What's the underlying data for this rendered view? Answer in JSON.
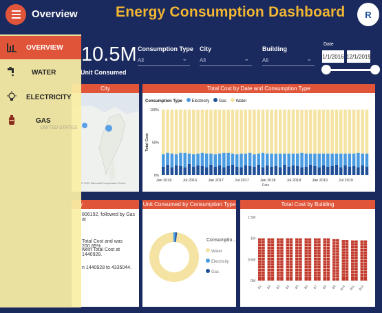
{
  "header": {
    "page_title": "Overview",
    "dashboard_title": "Energy Consumption Dashboard"
  },
  "kpi": {
    "value": "10.5M",
    "label": "Unit Consumed"
  },
  "filters": {
    "consumption_type": {
      "label": "Consumption Type",
      "value": "All"
    },
    "city": {
      "label": "City",
      "value": "All"
    },
    "building": {
      "label": "Building",
      "value": "All"
    },
    "date": {
      "label": "Date",
      "start": "1/1/2016",
      "end": "12/1/2019"
    }
  },
  "nav": {
    "items": [
      {
        "label": "OVERVIEW",
        "icon": "bar-chart-icon",
        "active": true
      },
      {
        "label": "WATER",
        "icon": "faucet-icon",
        "active": false
      },
      {
        "label": "ELECTRICITY",
        "icon": "bulb-icon",
        "active": false
      },
      {
        "label": "GAS",
        "icon": "gas-cylinder-icon",
        "active": false
      }
    ]
  },
  "map_panel": {
    "title": "City",
    "attribution": "© 2022 Microsoft Corporation  Terms",
    "faded_text": [
      "UNITED STATES"
    ]
  },
  "insights_panel": {
    "title": "y",
    "lines": [
      "806192, followed by Gas at",
      "Total Cost and was 200.85%",
      "west Total Cost at 1440928.",
      "n 1440928 to 4335044."
    ]
  },
  "cost_by_date_panel": {
    "title": "Total Cost by Date and Consumption Type",
    "legend_title": "Consumption Type",
    "xlabel": "Date",
    "ylabel": "Total Cost"
  },
  "unit_by_type_panel": {
    "title": "Unit Consumed by Consumption Type",
    "legend_title": "Consumptio...",
    "legend": [
      "Water",
      "Electricity",
      "Gas"
    ]
  },
  "cost_by_building_panel": {
    "title": "Total Cost by Building"
  },
  "colors": {
    "navy": "#1b2a5e",
    "accent_orange": "#e0553a",
    "title_gold": "#f2b632",
    "water": "#f5e3a3",
    "electricity": "#4a9be0",
    "gas": "#1f4f96",
    "building_bar": "#c0392b"
  },
  "chart_data": [
    {
      "type": "bar",
      "title": "Total Cost by Date and Consumption Type",
      "xlabel": "Date",
      "ylabel": "Total Cost",
      "stacked": "100%",
      "x_ticks": [
        "Jan 2016",
        "Jul 2016",
        "Jan 2017",
        "Jul 2017",
        "Jan 2018",
        "Jul 2018",
        "Jan 2019",
        "Jul 2019"
      ],
      "y_ticks": [
        "0%",
        "50%",
        "100%"
      ],
      "ylim": [
        0,
        100
      ],
      "n_periods": 48,
      "series": [
        {
          "name": "Gas",
          "values": [
            13,
            16,
            12,
            15,
            14,
            12,
            17,
            13,
            15,
            14,
            12,
            16,
            13,
            15,
            12,
            14,
            16,
            13,
            12,
            15,
            14,
            13,
            16,
            12,
            15,
            13,
            14,
            12,
            16,
            13,
            15,
            14,
            12,
            13,
            16,
            14,
            12,
            15,
            13,
            14,
            16,
            12,
            15,
            13,
            14,
            12,
            15,
            13
          ]
        },
        {
          "name": "Electricity",
          "values": [
            19,
            18,
            21,
            17,
            20,
            22,
            16,
            19,
            18,
            20,
            21,
            17,
            19,
            18,
            22,
            20,
            17,
            19,
            21,
            18,
            20,
            19,
            17,
            22,
            18,
            20,
            19,
            21,
            17,
            20,
            18,
            19,
            22,
            20,
            17,
            19,
            21,
            18,
            20,
            19,
            17,
            21,
            18,
            20,
            19,
            22,
            18,
            20
          ]
        },
        {
          "name": "Water",
          "values": [
            68,
            66,
            67,
            68,
            66,
            66,
            67,
            68,
            67,
            66,
            67,
            67,
            68,
            67,
            66,
            66,
            67,
            68,
            67,
            67,
            66,
            68,
            67,
            66,
            67,
            67,
            67,
            67,
            67,
            67,
            67,
            67,
            66,
            67,
            67,
            67,
            67,
            67,
            67,
            67,
            67,
            67,
            67,
            67,
            67,
            66,
            67,
            67
          ]
        }
      ]
    },
    {
      "type": "pie",
      "title": "Unit Consumed by Consumption Type",
      "donut": true,
      "categories": [
        "Water",
        "Electricity",
        "Gas"
      ],
      "values": [
        97.5,
        1.5,
        1.0
      ]
    },
    {
      "type": "bar",
      "title": "Total Cost by Building",
      "y_ticks": [
        "0M",
        "0.5M",
        "1M",
        "1.5M"
      ],
      "ylim": [
        0,
        1.5
      ],
      "categories": [
        "B1",
        "B2",
        "B3",
        "B4",
        "B5",
        "B6",
        "B7",
        "B8",
        "B9",
        "B10",
        "B11",
        "B12"
      ],
      "values": [
        1.0,
        1.0,
        1.0,
        1.0,
        1.0,
        1.0,
        1.0,
        1.0,
        0.98,
        0.96,
        0.95,
        0.95
      ]
    }
  ]
}
